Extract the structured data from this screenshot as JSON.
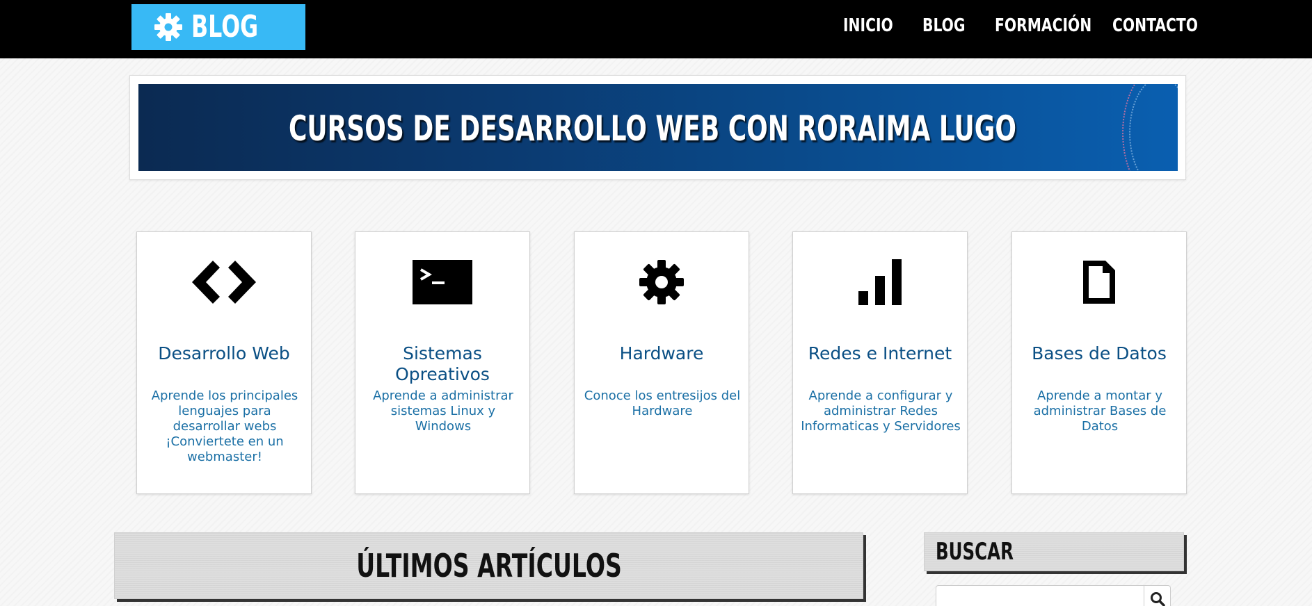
{
  "header": {
    "logo_text": "BLOG",
    "logo_icon": "gear-icon",
    "nav": [
      {
        "label": "INICIO"
      },
      {
        "label": "BLOG"
      },
      {
        "label": "FORMACIÓN"
      },
      {
        "label": "CONTACTO"
      }
    ]
  },
  "banner": {
    "title": "CURSOS DE DESARROLLO WEB CON RORAIMA LUGO"
  },
  "categories": [
    {
      "icon": "code-icon",
      "title": "Desarrollo Web",
      "description": "Aprende los principales lenguajes para desarrollar webs ¡Conviertete en un webmaster!"
    },
    {
      "icon": "terminal-icon",
      "title": "Sistemas Opreativos",
      "description": "Aprende a administrar sistemas Linux y Windows"
    },
    {
      "icon": "gear-icon",
      "title": "Hardware",
      "description": "Conoce los entresijos del Hardware"
    },
    {
      "icon": "signal-bars-icon",
      "title": "Redes e Internet",
      "description": "Aprende a configurar y administrar Redes Informaticas y Servidores"
    },
    {
      "icon": "document-icon",
      "title": "Bases de Datos",
      "description": "Aprende a montar y administrar Bases de Datos"
    }
  ],
  "articles": {
    "title": "ÚLTIMOS ARTÍCULOS"
  },
  "sidebar": {
    "search_title": "BUSCAR",
    "search_value": "",
    "search_icon": "search-icon"
  },
  "colors": {
    "topbar": "#000000",
    "logo_bg": "#38b9f5",
    "card_title": "#0a4f84",
    "card_desc": "#1a6fa5"
  }
}
